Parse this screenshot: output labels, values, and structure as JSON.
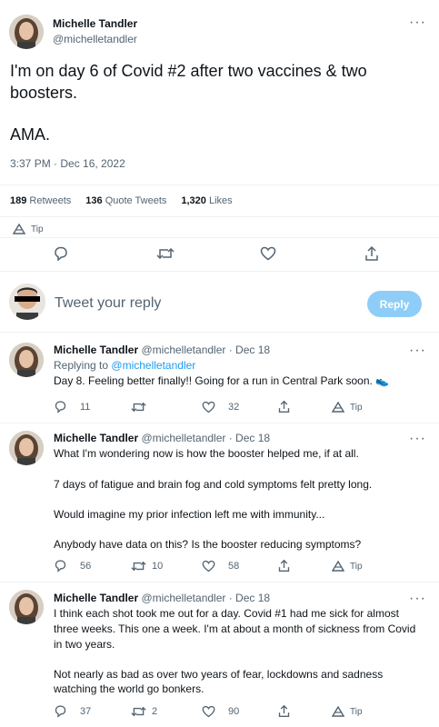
{
  "main_tweet": {
    "author_name": "Michelle Tandler",
    "handle": "@michelletandler",
    "text_line1": "I'm on day 6 of Covid #2 after two vaccines & two",
    "text_line2": "boosters.",
    "text_line3": "AMA.",
    "timestamp": "3:37 PM · Dec 16, 2022",
    "stats": {
      "retweets_count": "189",
      "retweets_label": "Retweets",
      "quote_count": "136",
      "quote_label": "Quote Tweets",
      "likes_count": "1,320",
      "likes_label": "Likes"
    },
    "tip_label": "Tip"
  },
  "compose": {
    "placeholder": "Tweet your reply",
    "reply_button": "Reply"
  },
  "replies": [
    {
      "author_name": "Michelle Tandler",
      "handle_date": "@michelletandler · Dec 18",
      "replying_prefix": "Replying to",
      "replying_handle": "@michelletandler",
      "lines": [
        "Day 8. Feeling better finally!! Going for a run in Central Park soon. 👟"
      ],
      "reply_count": "11",
      "retweet_count": "",
      "like_count": "32",
      "tip_label": "Tip"
    },
    {
      "author_name": "Michelle Tandler",
      "handle_date": "@michelletandler · Dec 18",
      "lines": [
        "What I'm wondering now is how the booster helped me, if at all.",
        "7 days of fatigue and brain fog and cold symptoms felt pretty long.",
        "Would imagine my prior infection left me with immunity...",
        "Anybody have data on this? Is the booster reducing symptoms?"
      ],
      "reply_count": "56",
      "retweet_count": "10",
      "like_count": "58",
      "tip_label": "Tip"
    },
    {
      "author_name": "Michelle Tandler",
      "handle_date": "@michelletandler · Dec 18",
      "lines": [
        "I think each shot took me out for a day. Covid #1 had me sick for almost",
        "three weeks. This one a week. I'm at about a month of sickness from Covid",
        "in two years.",
        "Not nearly as bad as over two years of fear, lockdowns and sadness",
        "watching the world go bonkers."
      ],
      "reply_count": "37",
      "retweet_count": "2",
      "like_count": "90",
      "tip_label": "Tip"
    }
  ],
  "colors": {
    "accent": "#1d9bf0",
    "reply_button_bg": "#8ecdf8",
    "text": "#0f1419",
    "muted": "#536471"
  },
  "icons": {
    "reply": "reply-icon",
    "retweet": "retweet-icon",
    "like": "heart-icon",
    "share": "share-icon",
    "tip": "tip-icon",
    "more": "more-icon"
  }
}
